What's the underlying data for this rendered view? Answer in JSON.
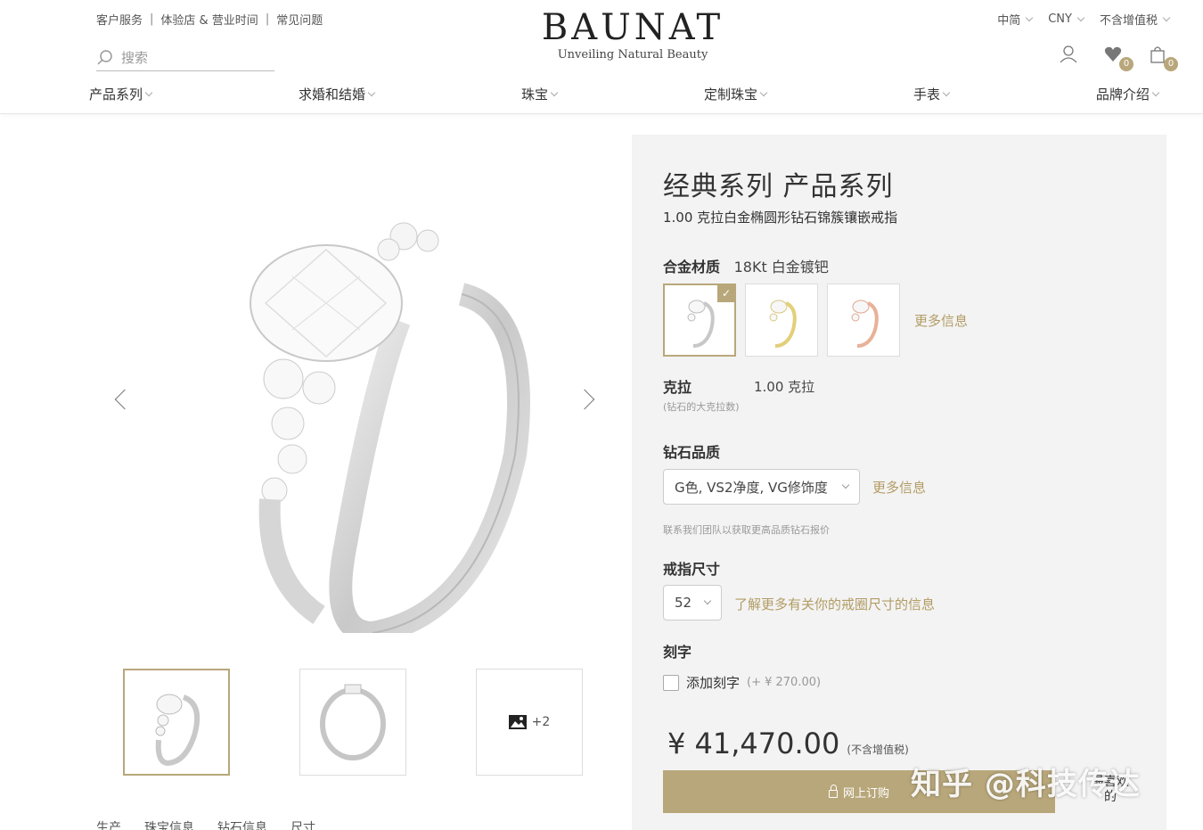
{
  "header": {
    "util_links": [
      "客户服务",
      "体验店 & 营业时间",
      "常见问题"
    ],
    "search_placeholder": "搜索",
    "brand": "BAUNAT",
    "tagline": "Unveiling Natural Beauty",
    "language": "中简",
    "currency": "CNY",
    "tax_mode": "不含增值税",
    "wishlist_count": "0",
    "cart_count": "0"
  },
  "nav": [
    "产品系列",
    "求婚和结婚",
    "珠宝",
    "定制珠宝",
    "手表",
    "品牌介绍"
  ],
  "gallery": {
    "more_count": "+2"
  },
  "tabs": [
    "生产",
    "珠宝信息",
    "钻石信息",
    "尺寸"
  ],
  "product": {
    "title": "经典系列 产品系列",
    "subtitle": "1.00 克拉白金椭圆形钻石锦簇镶嵌戒指",
    "metal_label": "合金材质",
    "metal_value": "18Kt 白金镀钯",
    "metal_more": "更多信息",
    "carat_label": "克拉",
    "carat_note": "(钻石的大克拉数)",
    "carat_value": "1.00 克拉",
    "quality_label": "钻石品质",
    "quality_value": "G色, VS2净度, VG修饰度",
    "quality_more": "更多信息",
    "quality_hint": "联系我们团队以获取更高品质钻石报价",
    "size_label": "戒指尺寸",
    "size_value": "52",
    "size_link": "了解更多有关你的戒圈尺寸的信息",
    "engrave_label": "刻字",
    "engrave_option": "添加刻字",
    "engrave_price": "(+ ¥ 270.00)",
    "price": "¥ 41,470.00",
    "price_tax": "(不含增值税)",
    "buy_label": "网上订购",
    "side_tag": "最喜欢的"
  },
  "watermark": "知乎 @科技传达",
  "colors": {
    "accent": "#b8a77a",
    "panel_bg": "#f3f3f3"
  }
}
